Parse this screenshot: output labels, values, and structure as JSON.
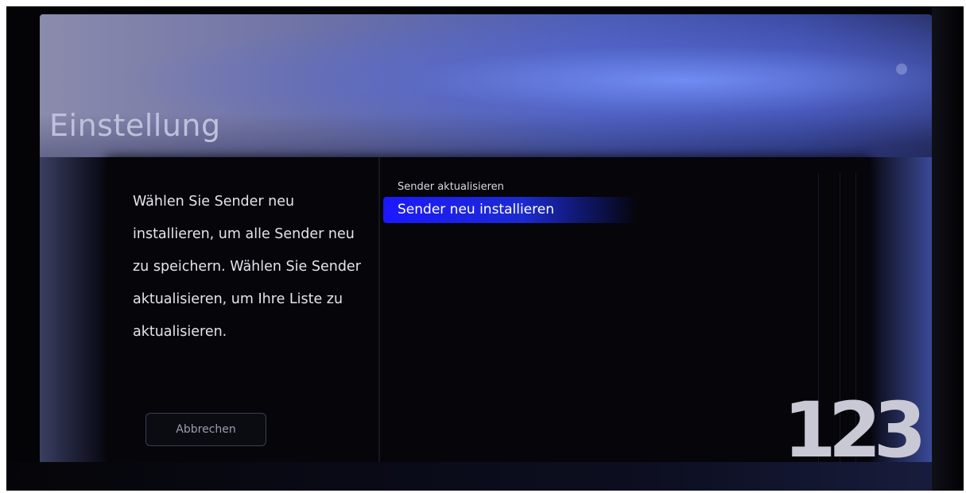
{
  "screen": {
    "title": "Einstellung"
  },
  "description_text": "Wählen Sie Sender neu installieren, um alle Sender neu zu speichern. Wählen Sie Sender aktualisieren, um Ihre Liste zu aktualisieren.",
  "buttons": {
    "cancel_label": "Abbrechen"
  },
  "options": [
    {
      "label": "Sender aktualisieren",
      "selected": false
    },
    {
      "label": "Sender neu installieren",
      "selected": true
    }
  ],
  "channel_number": "123",
  "colors": {
    "selection_accent": "#1c18ff",
    "header_blue": "#4c5cb4",
    "panel_background": "#05050a"
  }
}
